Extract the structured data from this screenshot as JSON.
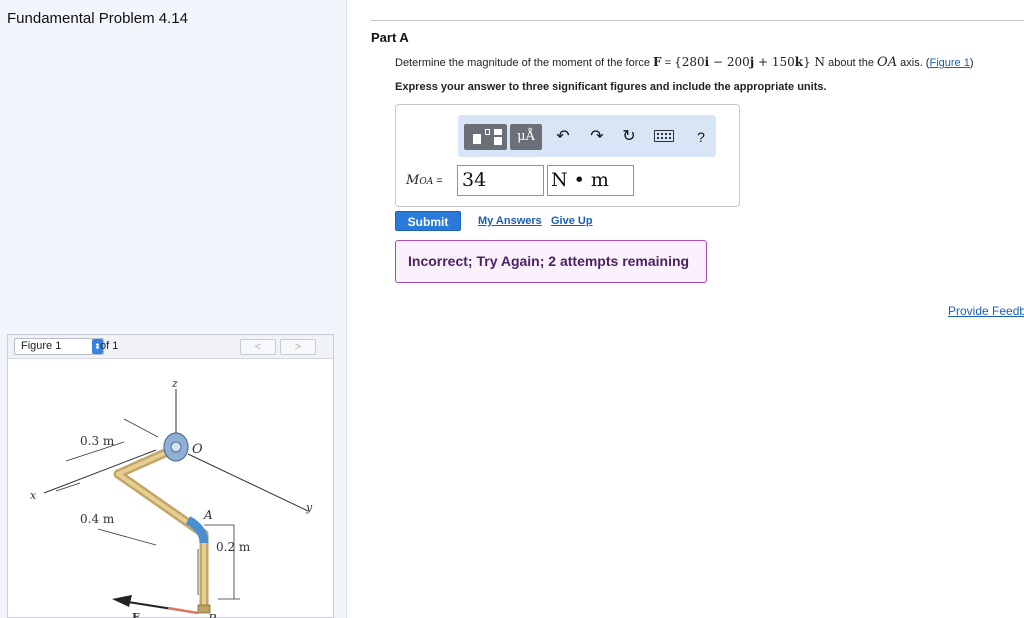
{
  "left": {
    "problem_title": "Fundamental Problem 4.14",
    "figure": {
      "select_value": "Figure 1",
      "of_label": "of 1",
      "prev_label": "<",
      "next_label": ">",
      "labels": {
        "z": "z",
        "x": "x",
        "y": "y",
        "o": "O",
        "a": "A",
        "b": "B",
        "f": "F",
        "d1": "0.3 m",
        "d2": "0.4 m",
        "d3": "0.2 m"
      }
    }
  },
  "part": {
    "title": "Part A",
    "question_prefix": "Determine the magnitude of the moment of the force ",
    "force_symbol": "F",
    "equals": " = ",
    "force_expr_open": "{280",
    "i": "i",
    "minus": " − 200",
    "j": "j",
    "plus": " + 150",
    "k": "k",
    "force_expr_close": "} N",
    "about_the": " about the ",
    "axis_symbol": "OA",
    "axis_suffix": " axis. (",
    "figure_link": "Figure 1",
    "close_paren": ")",
    "instruction": "Express your answer to three significant figures and include the appropriate units."
  },
  "answer": {
    "label_main": "M",
    "label_sub": "OA",
    "label_eq": " =",
    "value": "34",
    "units": "N • m",
    "toolbar": {
      "mu_label": "μÅ",
      "undo": "↶",
      "redo": "↷",
      "reset": "↻",
      "help": "?"
    }
  },
  "actions": {
    "submit_label": "Submit",
    "my_answers_label": "My Answers",
    "give_up_label": "Give Up"
  },
  "feedback": {
    "message": "Incorrect; Try Again; 2 attempts remaining"
  },
  "provide_feedback_label": "Provide Feedb",
  "colors": {
    "accent_blue": "#2a7ad9",
    "link_blue": "#1a5fb4",
    "feedback_border": "#a44cba",
    "feedback_bg": "#fbf1fd",
    "toolbar_bg": "#d8e5f6"
  }
}
